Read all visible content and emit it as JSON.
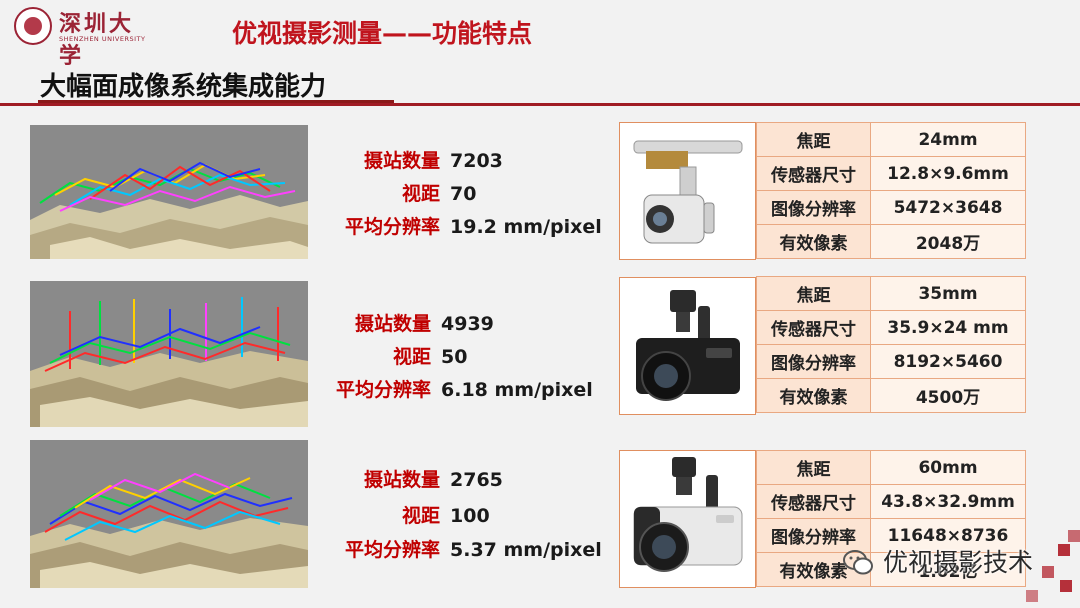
{
  "logo": {
    "cn": "深圳大学",
    "en": "SHENZHEN UNIVERSITY"
  },
  "header": {
    "title": "优视摄影测量——功能特点",
    "subtitle": "大幅面成像系统集成能力"
  },
  "colors": {
    "accent_red": "#c00000",
    "table_border": "#e9a882",
    "table_key_bg": "#fce4d3",
    "table_value_bg": "#fef3ea"
  },
  "rows": [
    {
      "stats": [
        {
          "label": "摄站数量",
          "value": "7203"
        },
        {
          "label": "视距",
          "value": "70"
        },
        {
          "label": "平均分辨率",
          "value": "19.2 mm/pixel"
        }
      ],
      "specs": [
        {
          "key": "焦距",
          "value": "24mm"
        },
        {
          "key": "传感器尺寸",
          "value": "12.8×9.6mm"
        },
        {
          "key": "图像分辨率",
          "value": "5472×3648"
        },
        {
          "key": "有效像素",
          "value": "2048万"
        }
      ]
    },
    {
      "stats": [
        {
          "label": "摄站数量",
          "value": "4939"
        },
        {
          "label": "视距",
          "value": "50"
        },
        {
          "label": "平均分辨率",
          "value": "6.18 mm/pixel"
        }
      ],
      "specs": [
        {
          "key": "焦距",
          "value": "35mm"
        },
        {
          "key": "传感器尺寸",
          "value": "35.9×24 mm"
        },
        {
          "key": "图像分辨率",
          "value": "8192×5460"
        },
        {
          "key": "有效像素",
          "value": "4500万"
        }
      ]
    },
    {
      "stats": [
        {
          "label": "摄站数量",
          "value": "2765"
        },
        {
          "label": "视距",
          "value": "100"
        },
        {
          "label": "平均分辨率",
          "value": "5.37 mm/pixel"
        }
      ],
      "specs": [
        {
          "key": "焦距",
          "value": "60mm"
        },
        {
          "key": "传感器尺寸",
          "value": "43.8×32.9mm"
        },
        {
          "key": "图像分辨率",
          "value": "11648×8736"
        },
        {
          "key": "有效像素",
          "value": "1.02亿"
        }
      ]
    }
  ],
  "watermark": {
    "text": "优视摄影技术",
    "icon": "wechat-icon"
  }
}
